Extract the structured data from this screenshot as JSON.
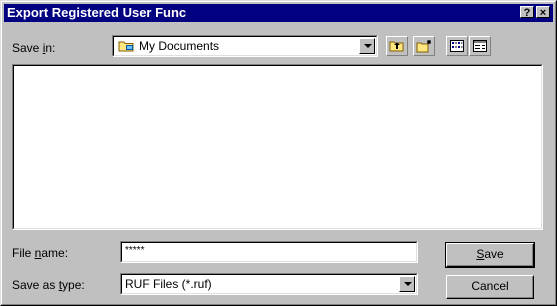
{
  "window": {
    "title": "Export Registered User Func",
    "help_glyph": "?",
    "close_glyph": "×"
  },
  "save_in": {
    "label_pre": "Save ",
    "label_key": "i",
    "label_post": "n:",
    "value": "My Documents"
  },
  "file_name": {
    "label_pre": "File ",
    "label_key": "n",
    "label_post": "ame:",
    "value": "*****"
  },
  "save_as_type": {
    "label_pre": "Save as ",
    "label_key": "t",
    "label_post": "ype:",
    "value": "RUF Files (*.ruf)"
  },
  "buttons": {
    "save_key": "S",
    "save_rest": "ave",
    "cancel": "Cancel"
  },
  "icons": {
    "folder": "folder-icon",
    "up": "up-one-level-icon",
    "new_folder": "new-folder-icon",
    "list": "list-view-icon",
    "details": "details-view-icon"
  }
}
